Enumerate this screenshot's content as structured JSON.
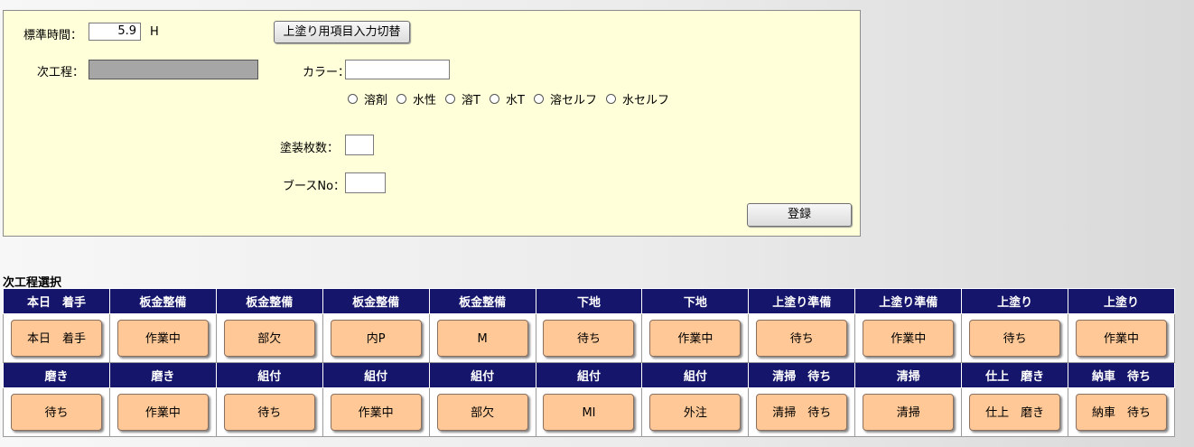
{
  "form": {
    "std_time_label": "標準時間：",
    "std_time_value": "5.9",
    "std_time_unit": "H",
    "toggle_button": "上塗り用項目入力切替",
    "next_process_label": "次工程：",
    "next_process_value": "",
    "color_label": "カラー：",
    "color_value": "",
    "paint_types": [
      "溶剤",
      "水性",
      "溶T",
      "水T",
      "溶セルフ",
      "水セルフ"
    ],
    "sheets_label": "塗装枚数：",
    "sheets_value": "",
    "booth_label": "ブースNo：",
    "booth_value": "",
    "register_button": "登録"
  },
  "next_select": {
    "title": "次工程選択",
    "rows": [
      {
        "headers": [
          "本日　着手",
          "板金整備",
          "板金整備",
          "板金整備",
          "板金整備",
          "下地",
          "下地",
          "上塗り準備",
          "上塗り準備",
          "上塗り",
          "上塗り"
        ],
        "buttons": [
          "本日　着手",
          "作業中",
          "部欠",
          "内P",
          "M",
          "待ち",
          "作業中",
          "待ち",
          "作業中",
          "待ち",
          "作業中"
        ]
      },
      {
        "headers": [
          "磨き",
          "磨き",
          "組付",
          "組付",
          "組付",
          "組付",
          "組付",
          "清掃　待ち",
          "清掃",
          "仕上　磨き",
          "納車　待ち"
        ],
        "buttons": [
          "待ち",
          "作業中",
          "待ち",
          "作業中",
          "部欠",
          "MI",
          "外注",
          "清掃　待ち",
          "清掃",
          "仕上　磨き",
          "納車　待ち"
        ]
      }
    ]
  }
}
